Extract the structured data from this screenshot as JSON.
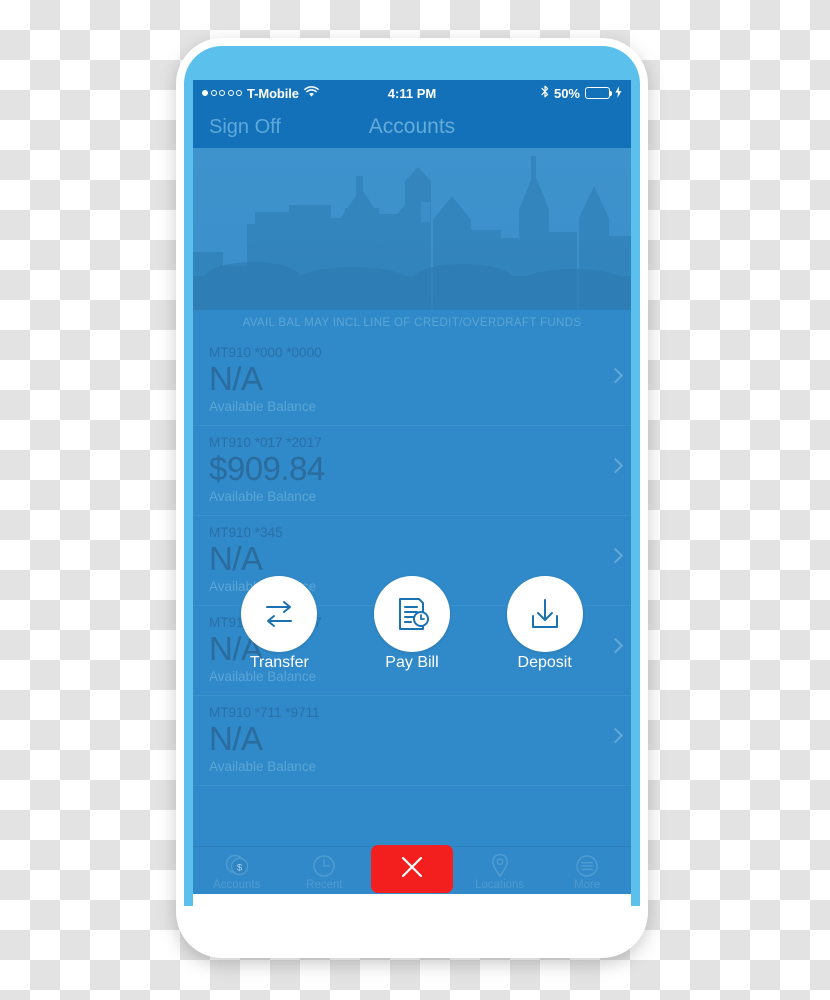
{
  "status_bar": {
    "carrier": "T-Mobile",
    "signal_dots_total": 5,
    "signal_dots_filled": 1,
    "wifi_icon": "wifi-icon",
    "time": "4:11 PM",
    "bluetooth_icon": "bluetooth-icon",
    "battery_percent_label": "50%",
    "battery_level": 50,
    "charging_icon": "lightning-bolt-icon",
    "battery_fill_color": "#4cd964"
  },
  "navbar": {
    "sign_off_label": "Sign Off",
    "title": "Accounts"
  },
  "hero": {
    "image_name": "city-skyline-philadelphia"
  },
  "disclaimer": "AVAIL BAL MAY INCL LINE OF CREDIT/OVERDRAFT FUNDS",
  "accounts": [
    {
      "number": "MT910 *000 *0000",
      "balance": "N/A",
      "sublabel": "Available Balance"
    },
    {
      "number": "MT910 *017 *2017",
      "balance": "$909.84",
      "sublabel": "Available Balance"
    },
    {
      "number": "MT910 *345",
      "balance": "N/A",
      "sublabel": "Available Balance"
    },
    {
      "number": "MT910 *357 *6357",
      "balance": "N/A",
      "sublabel": "Available Balance"
    },
    {
      "number": "MT910 *711 *9711",
      "balance": "N/A",
      "sublabel": "Available Balance"
    }
  ],
  "actions": [
    {
      "label": "Transfer",
      "icon": "transfer-arrows-icon"
    },
    {
      "label": "Pay Bill",
      "icon": "bill-document-icon"
    },
    {
      "label": "Deposit",
      "icon": "deposit-download-icon"
    }
  ],
  "tabs": [
    {
      "label": "Accounts",
      "icon": "coins-dollar-icon",
      "active": true
    },
    {
      "label": "Recent",
      "icon": "clock-icon",
      "active": false
    },
    {
      "label": "Locations",
      "icon": "map-pin-icon",
      "active": false
    },
    {
      "label": "More",
      "icon": "hamburger-circle-icon",
      "active": false
    }
  ],
  "close_button": {
    "icon": "close-x-icon",
    "color": "#f31f1f"
  },
  "theme": {
    "screen_background": "#3089c8",
    "navbar_background": "#1271b8",
    "phone_frame_accent": "#5bc0ec",
    "accent_white": "#ffffff"
  }
}
